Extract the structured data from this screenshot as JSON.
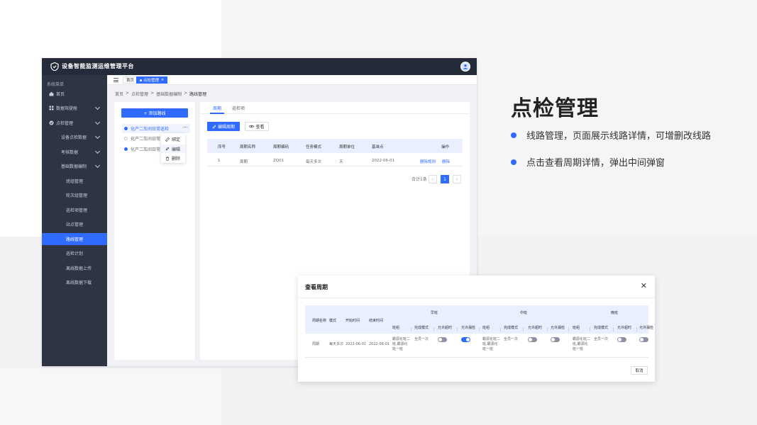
{
  "app": {
    "title": "设备智能监测运维管理平台",
    "sidebar_header": "系统菜单",
    "menu": [
      {
        "label": "首页",
        "icon": "home-icon"
      },
      {
        "label": "数据驾驶舱",
        "icon": "grid-icon"
      },
      {
        "label": "点检管理",
        "icon": "check-icon"
      },
      {
        "label": "设备点检数据"
      },
      {
        "label": "考核数据"
      },
      {
        "label": "基础数据编制"
      },
      {
        "label": "班组管理"
      },
      {
        "label": "轮次组管理"
      },
      {
        "label": "巡检项管理"
      },
      {
        "label": "站点管理"
      },
      {
        "label": "路线管理"
      },
      {
        "label": "巡检计划"
      },
      {
        "label": "离线数据上传"
      },
      {
        "label": "离线数据下载"
      }
    ],
    "tabs": {
      "home": "首页",
      "active": "点检管理"
    },
    "breadcrumb": [
      "首页",
      "点检管理",
      "基础数据编制",
      "路线管理"
    ],
    "route_tree": {
      "add_button": "+ 添加路线",
      "items": [
        "化产二车间日常巡检",
        "化产二车间日常",
        "化产二车间日常"
      ],
      "context_menu": [
        "绑定",
        "编辑",
        "删除"
      ]
    },
    "content": {
      "tabs": [
        "周期",
        "巡检项"
      ],
      "edit_button": "编辑周期",
      "view_button": "查看",
      "table": {
        "headers": [
          "序号",
          "周期名称",
          "周期编码",
          "任务模式",
          "周期单位",
          "基准点",
          "操作"
        ],
        "rows": [
          {
            "no": "1",
            "name": "周期",
            "code": "ZQ01",
            "mode": "每天多次",
            "unit": "天",
            "base": "2022-06-01",
            "action1": "删除规则",
            "action2": "删除"
          }
        ]
      },
      "pagination": {
        "total": "合计1条",
        "current": "1"
      }
    }
  },
  "slide": {
    "heading": "点检管理",
    "bullets": [
      "线路管理，页面展示线路详情，可增删改线路",
      "点击查看周期详情，弹出中间弹窗"
    ]
  },
  "modal": {
    "title": "查看周期",
    "headers": {
      "name": "周期名称",
      "mode": "模式",
      "start": "开始时间",
      "end": "结束时间",
      "shifts": [
        "早班",
        "中班",
        "晚班"
      ],
      "sub": [
        "班组",
        "完成模式",
        "允许超时",
        "允许漏检"
      ]
    },
    "row": {
      "name": "周期",
      "mode": "每天多次",
      "start": "2022-06-01",
      "end": "2022-06-01",
      "teams": [
        "霸源化班二班,霸源化班一班",
        "霸源化班二班,霸源化班一班",
        "霸源化班二班,霸源化班一班"
      ],
      "completion": [
        "全员一次",
        "全员一次",
        "全员一次"
      ]
    },
    "cancel": "取消"
  },
  "colors": {
    "accent": "#2f6bff",
    "topbar": "#252b3a",
    "sidebar": "#2f3445"
  }
}
